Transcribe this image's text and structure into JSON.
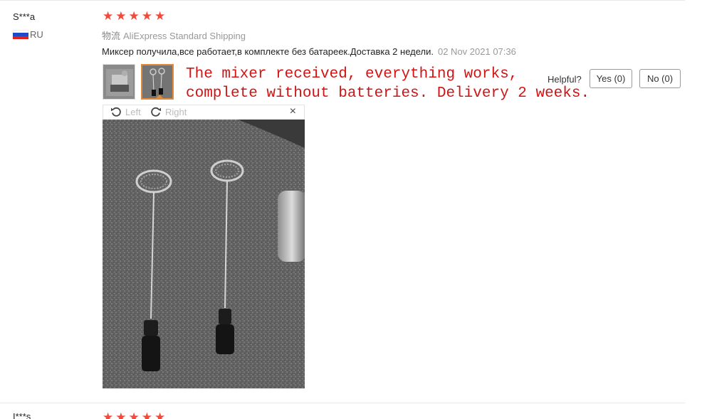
{
  "review": {
    "user": "S***a",
    "country_code": "RU",
    "rating_stars": 5,
    "shipping_prefix": "物流",
    "shipping": "AliExpress Standard Shipping",
    "text": "Миксер получила,все работает,в комплекте без батареек.Доставка 2 недели.",
    "date": "02 Nov 2021 07:36",
    "translation_line1": "The mixer received, everything works,",
    "translation_line2": "complete without batteries. Delivery 2 weeks.",
    "helpful_label": "Helpful?",
    "yes_label": "Yes (0)",
    "no_label": "No (0)"
  },
  "viewer": {
    "rotate_left_label": "Left",
    "rotate_right_label": "Right",
    "close_glyph": "×"
  },
  "next_review": {
    "user": "I***s",
    "rating_stars": 5
  },
  "colors": {
    "star": "#f04a3a",
    "translation": "#d01414",
    "selected_thumb_border": "#e08a3a"
  },
  "icons": {
    "rotate_left": "rotate-left-icon",
    "rotate_right": "rotate-right-icon",
    "close": "close-icon"
  }
}
